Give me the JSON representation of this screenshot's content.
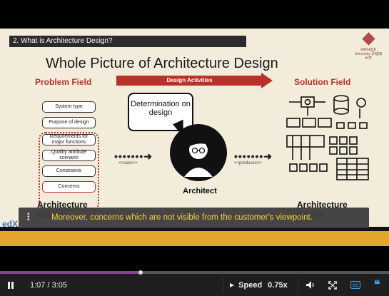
{
  "slide": {
    "chapter": "2. What is Architecture Design?",
    "logo_text": "WASEDA University 早稲田大学",
    "title": "Whole Picture of Architecture Design",
    "problem_field": "Problem Field",
    "solution_field": "Solution Field",
    "design_activities": "Design Activities",
    "boxes": [
      "System type",
      "Purpose of design",
      "Requirements for major functions",
      "Quality attribute scenario",
      "Constraints",
      "Concerns"
    ],
    "uses_label": "<<uses>>",
    "produces_label": "<<produces>>",
    "bubble": "Determination on design",
    "architect": "Architect",
    "drivers": "Architecture drivers",
    "design_out": "Architecture design"
  },
  "subtitle": "Moreover, concerns which are not visible from the customer's viewpoint.",
  "branding": "edX",
  "player": {
    "time": "1:07 / 3:05",
    "progress": 0.362,
    "speed_label": "Speed",
    "speed_value": "0.75x",
    "accent": "#8c3e99",
    "icons": [
      "pause-icon",
      "chevron-right-icon",
      "volume-icon",
      "fullscreen-icon",
      "captions-icon",
      "transcript-icon"
    ]
  }
}
